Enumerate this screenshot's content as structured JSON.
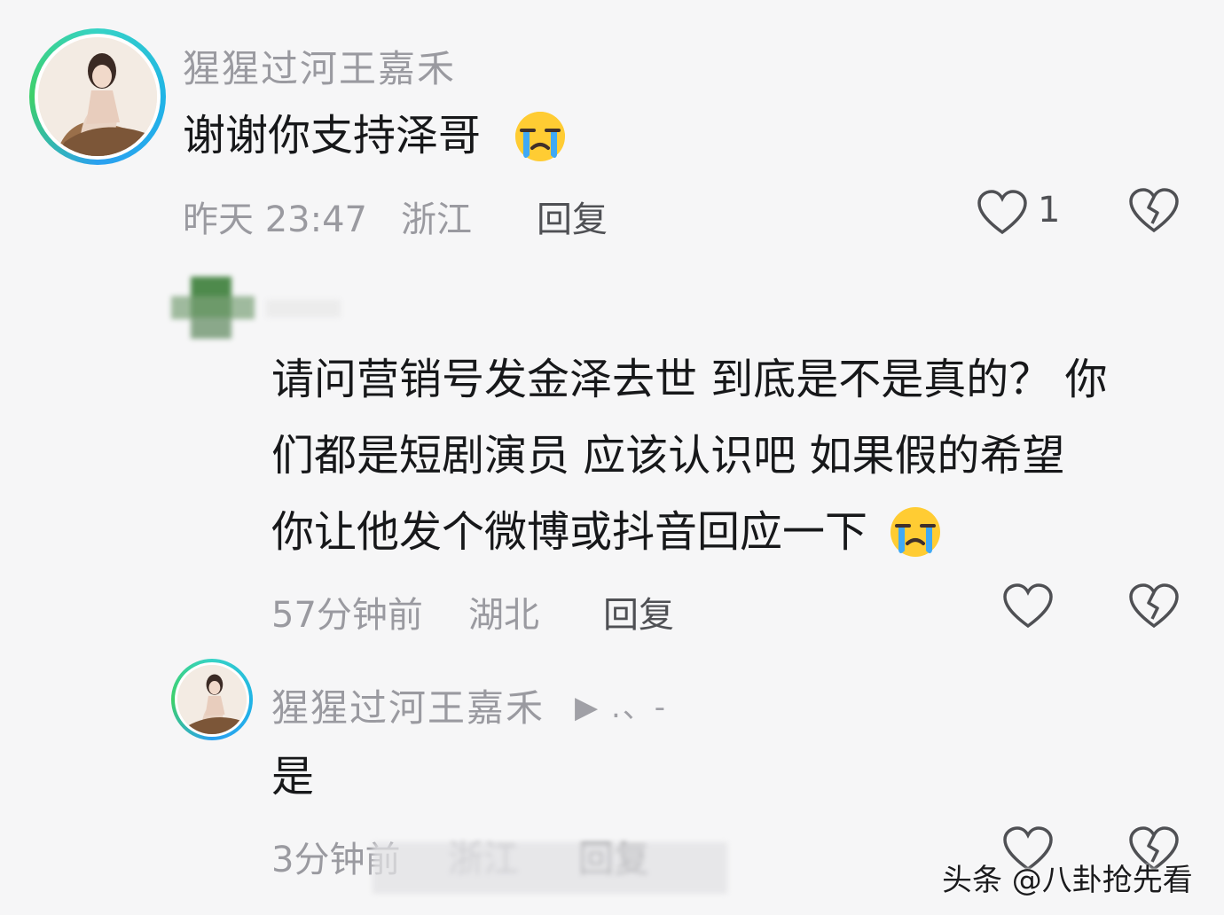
{
  "comments": [
    {
      "username": "猩猩过河王嘉禾",
      "text": "谢谢你支持泽哥",
      "emoji": "crying-emoji",
      "time": "昨天 23:47",
      "location": "浙江",
      "reply_label": "回复",
      "like_count": "1"
    },
    {
      "username": "",
      "text_lines": [
        "请问营销号发金泽去世 到底是不是真的？ 你",
        "们都是短剧演员 应该认识吧  如果假的希望",
        "你让他发个微博或抖音回应一下"
      ],
      "emoji": "crying-emoji",
      "time": "57分钟前",
      "location": "湖北",
      "reply_label": "回复"
    },
    {
      "username": "猩猩过河王嘉禾",
      "suffix": "▶ .、-",
      "text": "是",
      "time": "3分钟前",
      "location": "浙江",
      "reply_label": "回复"
    }
  ],
  "watermark": "头条 @八卦抢先看",
  "colors": {
    "background": "#f6f6f7",
    "meta": "#9a9aa0",
    "text": "#17181a",
    "ring": "#20b4e6"
  }
}
